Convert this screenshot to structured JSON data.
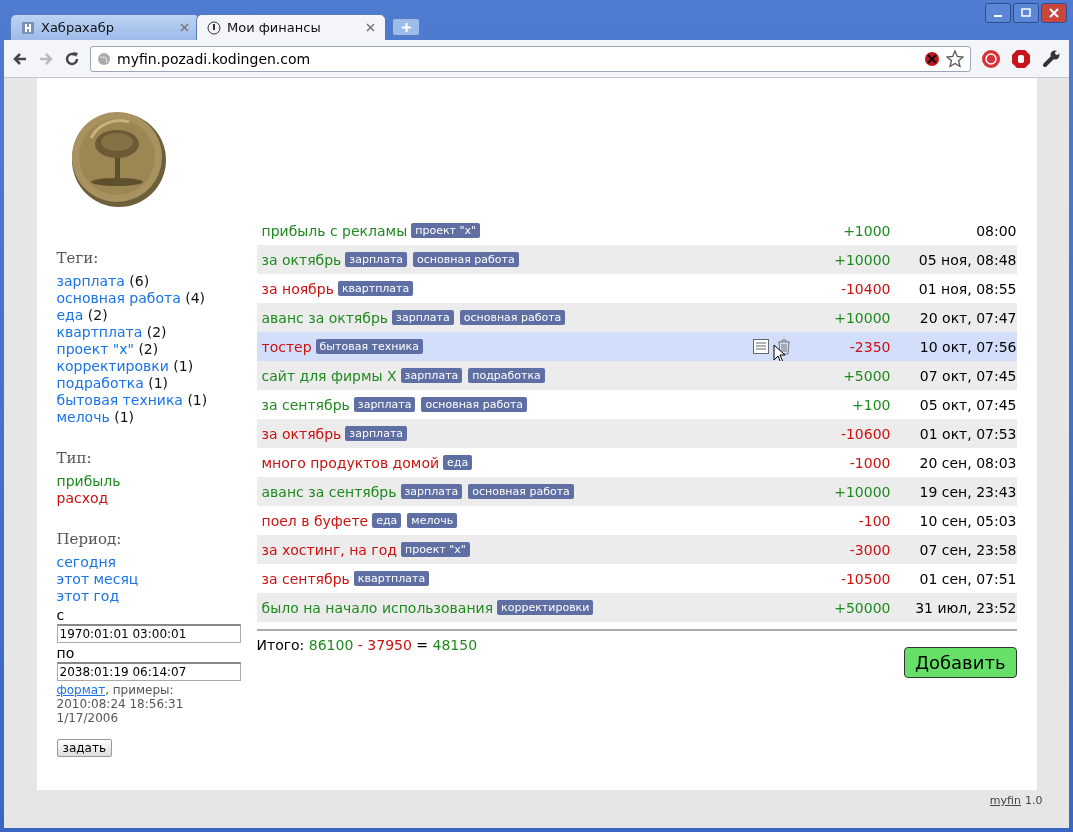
{
  "browser": {
    "tabs": [
      {
        "title": "Хабрахабр",
        "selected": false
      },
      {
        "title": "Мои финансы",
        "selected": true
      }
    ],
    "address": "myfin.pozadi.kodingen.com"
  },
  "sidebar": {
    "tags_heading": "Теги:",
    "tags": [
      {
        "label": "зарплата",
        "count": "(6)"
      },
      {
        "label": "основная работа",
        "count": "(4)"
      },
      {
        "label": "еда",
        "count": "(2)"
      },
      {
        "label": "квартплата",
        "count": "(2)"
      },
      {
        "label": "проект \"x\"",
        "count": "(2)"
      },
      {
        "label": "корректировки",
        "count": "(1)"
      },
      {
        "label": "подработка",
        "count": "(1)"
      },
      {
        "label": "бытовая техника",
        "count": "(1)"
      },
      {
        "label": "мелочь",
        "count": "(1)"
      }
    ],
    "type_heading": "Тип:",
    "types": [
      {
        "label": "прибыль",
        "kind": "income"
      },
      {
        "label": "расход",
        "kind": "expense"
      }
    ],
    "period_heading": "Период:",
    "periods": [
      "сегодня",
      "этот месяц",
      "этот год"
    ],
    "from_label": "с",
    "from_value": "1970:01:01 03:00:01",
    "to_label": "по",
    "to_value": "2038:01:19 06:14:07",
    "format_link": "формат",
    "format_hint": ", примеры:",
    "examples": [
      "2010:08:24 18:56:31",
      "1/17/2006"
    ],
    "apply_button": "задать"
  },
  "transactions": [
    {
      "title": "прибыль с рекламы",
      "kind": "income",
      "tags": [
        "проект \"x\""
      ],
      "amount": "+1000",
      "date": "08:00",
      "hovered": false
    },
    {
      "title": "за октябрь",
      "kind": "income",
      "tags": [
        "зарплата",
        "основная работа"
      ],
      "amount": "+10000",
      "date": "05 ноя, 08:48",
      "hovered": false
    },
    {
      "title": "за ноябрь",
      "kind": "expense",
      "tags": [
        "квартплата"
      ],
      "amount": "-10400",
      "date": "01 ноя, 08:55",
      "hovered": false
    },
    {
      "title": "аванс за октябрь",
      "kind": "income",
      "tags": [
        "зарплата",
        "основная работа"
      ],
      "amount": "+10000",
      "date": "20 окт, 07:47",
      "hovered": false
    },
    {
      "title": "тостер",
      "kind": "expense",
      "tags": [
        "бытовая техника"
      ],
      "amount": "-2350",
      "date": "10 окт, 07:56",
      "hovered": true
    },
    {
      "title": "сайт для фирмы X",
      "kind": "income",
      "tags": [
        "зарплата",
        "подработка"
      ],
      "amount": "+5000",
      "date": "07 окт, 07:45",
      "hovered": false
    },
    {
      "title": "за сентябрь",
      "kind": "income",
      "tags": [
        "зарплата",
        "основная работа"
      ],
      "amount": "+100",
      "date": "05 окт, 07:45",
      "hovered": false
    },
    {
      "title": "за октябрь",
      "kind": "expense",
      "tags": [
        "зарплата"
      ],
      "amount": "-10600",
      "date": "01 окт, 07:53",
      "hovered": false
    },
    {
      "title": "много продуктов домой",
      "kind": "expense",
      "tags": [
        "еда"
      ],
      "amount": "-1000",
      "date": "20 сен, 08:03",
      "hovered": false
    },
    {
      "title": "аванс за сентябрь",
      "kind": "income",
      "tags": [
        "зарплата",
        "основная работа"
      ],
      "amount": "+10000",
      "date": "19 сен, 23:43",
      "hovered": false
    },
    {
      "title": "поел в буфете",
      "kind": "expense",
      "tags": [
        "еда",
        "мелочь"
      ],
      "amount": "-100",
      "date": "10 сен, 05:03",
      "hovered": false
    },
    {
      "title": "за хостинг, на год",
      "kind": "expense",
      "tags": [
        "проект \"x\""
      ],
      "amount": "-3000",
      "date": "07 сен, 23:58",
      "hovered": false
    },
    {
      "title": "за сентябрь",
      "kind": "expense",
      "tags": [
        "квартплата"
      ],
      "amount": "-10500",
      "date": "01 сен, 07:51",
      "hovered": false
    },
    {
      "title": "было на начало использования",
      "kind": "income",
      "tags": [
        "корректировки"
      ],
      "amount": "+50000",
      "date": "31 июл, 23:52",
      "hovered": false
    }
  ],
  "total": {
    "label": "Итого:",
    "income": "86100",
    "minus": "-",
    "expense": "37950",
    "equals": "=",
    "balance": "48150"
  },
  "add_button": "Добавить",
  "footer": {
    "link": "myfin",
    "version": "1.0"
  }
}
